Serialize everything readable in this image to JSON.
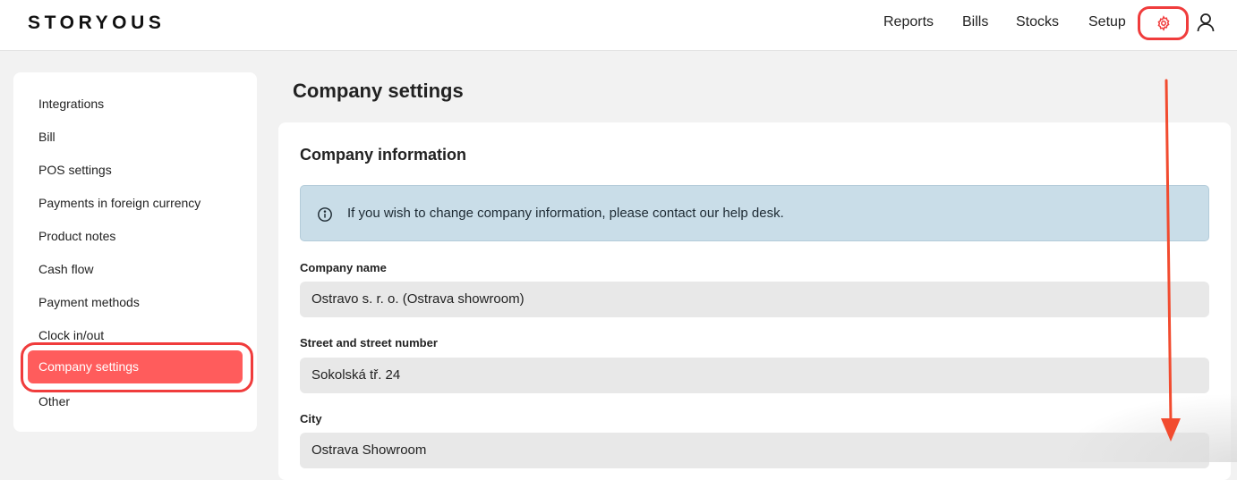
{
  "header": {
    "logo": "STORYOUS",
    "nav": [
      {
        "label": "Reports"
      },
      {
        "label": "Bills"
      },
      {
        "label": "Stocks"
      },
      {
        "label": "Setup"
      }
    ],
    "settings_icon": "gear-icon",
    "user_icon": "user-icon"
  },
  "sidebar": {
    "items": [
      {
        "label": "Integrations"
      },
      {
        "label": "Bill"
      },
      {
        "label": "POS settings"
      },
      {
        "label": "Payments in foreign currency"
      },
      {
        "label": "Product notes"
      },
      {
        "label": "Cash flow"
      },
      {
        "label": "Payment methods"
      },
      {
        "label": "Clock in/out"
      },
      {
        "label": "Company settings",
        "active": true
      },
      {
        "label": "Other"
      }
    ]
  },
  "main": {
    "title": "Company settings",
    "section": {
      "title": "Company information",
      "info_icon": "info-icon",
      "info_text": "If you wish to change company information, please contact our help desk.",
      "fields": [
        {
          "label": "Company name",
          "value": "Ostravo s. r. o. (Ostrava showroom)"
        },
        {
          "label": "Street and street number",
          "value": "Sokolská tř. 24"
        },
        {
          "label": "City",
          "value": "Ostrava Showroom"
        }
      ]
    }
  },
  "colors": {
    "accent": "#ff5c5c",
    "highlight_ring": "#f03c3c",
    "info_bg": "#c9dde8"
  }
}
